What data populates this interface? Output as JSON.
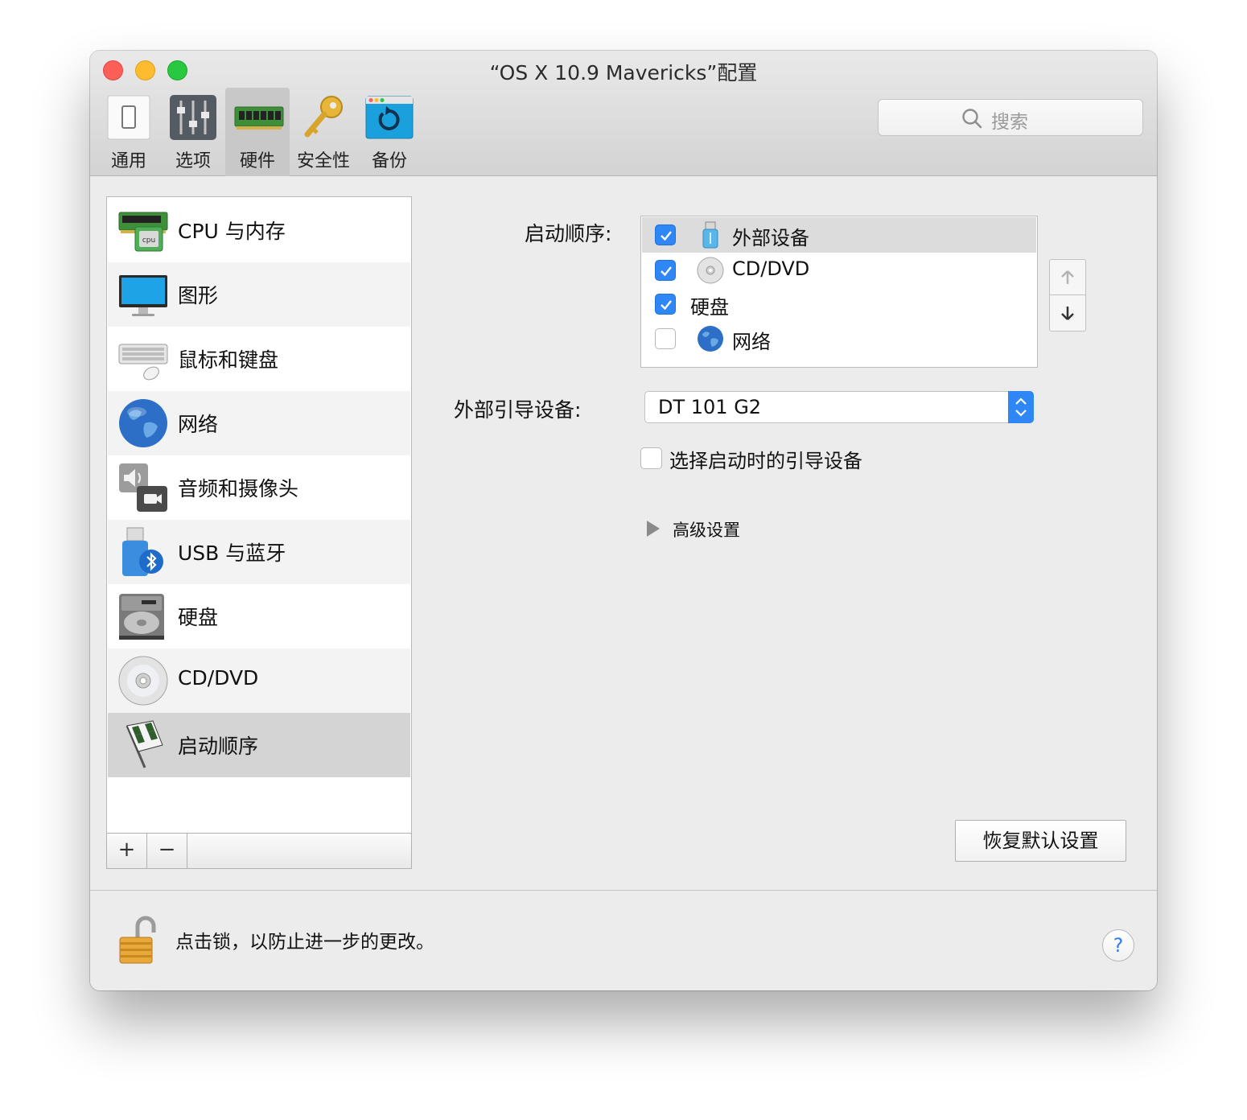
{
  "window": {
    "title": "“OS X 10.9 Mavericks”配置"
  },
  "toolbar": {
    "tabs": [
      {
        "label": "通用",
        "icon": "switch-icon"
      },
      {
        "label": "选项",
        "icon": "sliders-icon"
      },
      {
        "label": "硬件",
        "icon": "memory-chip-icon",
        "selected": true
      },
      {
        "label": "安全性",
        "icon": "key-icon"
      },
      {
        "label": "备份",
        "icon": "backup-icon"
      }
    ],
    "search_placeholder": "搜索"
  },
  "sidebar": {
    "items": [
      {
        "label": "CPU 与内存",
        "icon": "cpu-memory-icon"
      },
      {
        "label": "图形",
        "icon": "monitor-icon"
      },
      {
        "label": "鼠标和键盘",
        "icon": "keyboard-mouse-icon"
      },
      {
        "label": "网络",
        "icon": "globe-icon"
      },
      {
        "label": "音频和摄像头",
        "icon": "speaker-camera-icon"
      },
      {
        "label": "USB 与蓝牙",
        "icon": "usb-bluetooth-icon"
      },
      {
        "label": "硬盘",
        "icon": "hard-disk-icon"
      },
      {
        "label": "CD/DVD",
        "icon": "cd-dvd-icon"
      },
      {
        "label": "启动顺序",
        "icon": "checkered-flag-icon",
        "selected": true
      }
    ],
    "add_label": "+",
    "remove_label": "−"
  },
  "boot": {
    "label": "启动顺序:",
    "devices": [
      {
        "label": "外部设备",
        "checked": true,
        "icon": "usb-drive-icon",
        "selected": true
      },
      {
        "label": "CD/DVD",
        "checked": true,
        "icon": "cd-icon"
      },
      {
        "label": "硬盘",
        "checked": true,
        "icon": ""
      },
      {
        "label": "网络",
        "checked": false,
        "icon": "globe-icon"
      }
    ],
    "external_label": "外部引导设备:",
    "external_value": "DT 101 G2",
    "choose_at_start_label": "选择启动时的引导设备",
    "choose_at_start_checked": false,
    "advanced_label": "高级设置",
    "restore_label": "恢复默认设置"
  },
  "footer": {
    "lock_text": "点击锁，以防止进一步的更改。",
    "help_label": "?"
  },
  "colors": {
    "accent": "#2f87f5",
    "selected_row": "#d4d4d4"
  }
}
